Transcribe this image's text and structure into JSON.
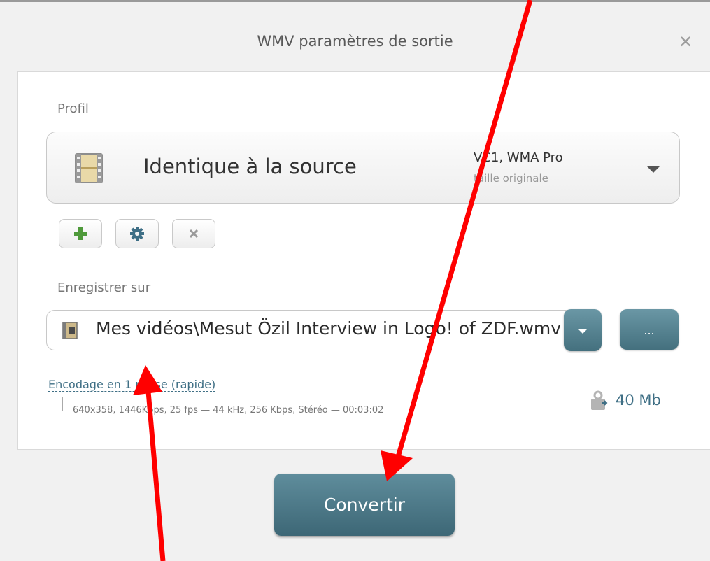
{
  "dialog": {
    "title": "WMV paramètres de sortie",
    "close_glyph": "✕"
  },
  "profile": {
    "label": "Profil",
    "name": "Identique à la source",
    "codec": "VC1, WMA Pro",
    "size": "taille originale",
    "icon": "film-icon"
  },
  "profile_actions": {
    "add_icon": "plus-icon",
    "settings_icon": "gear-icon",
    "remove_icon": "close-icon"
  },
  "output": {
    "label": "Enregistrer sur",
    "path": "Mes vidéos\\Mesut Özil Interview in Logo! of ZDF.wmv",
    "browse_label": "...",
    "dropdown_icon": "chevron-down-icon"
  },
  "encoding": {
    "mode_label": "Encodage en 1 passe (rapide)",
    "details": "640x358, 1446Kbps, 25 fps — 44 kHz, 256 Kbps, Stéréo — 00:03:02"
  },
  "file_size": "40 Mb",
  "convert_label": "Convertir",
  "colors": {
    "accent": "#4a7a89",
    "link": "#3f6f85",
    "annotation": "#ff0000"
  }
}
